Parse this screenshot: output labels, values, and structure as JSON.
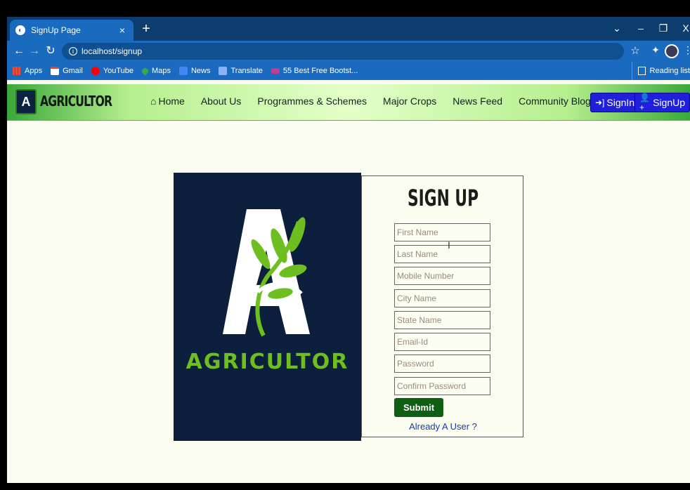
{
  "browser": {
    "tab_title": "SignUp Page",
    "tab_close": "×",
    "new_tab": "+",
    "url": "localhost/signup",
    "window_controls": {
      "dropdown": "⌄",
      "minimize": "–",
      "restore": "❐",
      "close": "X"
    },
    "bookmarks": [
      {
        "label": "Apps",
        "icon": "apps-icon",
        "color": "#e84c3d"
      },
      {
        "label": "Gmail",
        "icon": "gmail-icon",
        "color": "#ea4335"
      },
      {
        "label": "YouTube",
        "icon": "youtube-icon",
        "color": "#ff0000"
      },
      {
        "label": "Maps",
        "icon": "maps-icon",
        "color": "#34a853"
      },
      {
        "label": "News",
        "icon": "news-icon",
        "color": "#4285f4"
      },
      {
        "label": "Translate",
        "icon": "translate-icon",
        "color": "#4285f4"
      },
      {
        "label": "55 Best Free Bootst...",
        "icon": "bootstrap-icon",
        "color": "#c04090"
      }
    ],
    "reading_list": "Reading list"
  },
  "site": {
    "brand": "AGRICULTOR",
    "logo_letter": "A",
    "nav": [
      {
        "label": "Home",
        "icon": "home-icon"
      },
      {
        "label": "About Us"
      },
      {
        "label": "Programmes & Schemes"
      },
      {
        "label": "Major Crops"
      },
      {
        "label": "News Feed"
      },
      {
        "label": "Community Blog"
      }
    ],
    "signin_label": "SignIn",
    "signup_label": "SignUp"
  },
  "form": {
    "title": "SIGN UP",
    "fields": [
      "First Name",
      "Last Name",
      "Mobile Number",
      "City Name",
      "State Name",
      "Email-Id",
      "Password",
      "Confirm Password"
    ],
    "submit_label": "Submit",
    "already_user": "Already A User ?"
  },
  "hero": {
    "brand_text": "AGRICULTOR"
  },
  "colors": {
    "accent_blue": "#1f1fdc",
    "submit_green": "#0e5f14",
    "hero_bg": "#0c1f3c",
    "leaf_green": "#6cbf1f"
  }
}
